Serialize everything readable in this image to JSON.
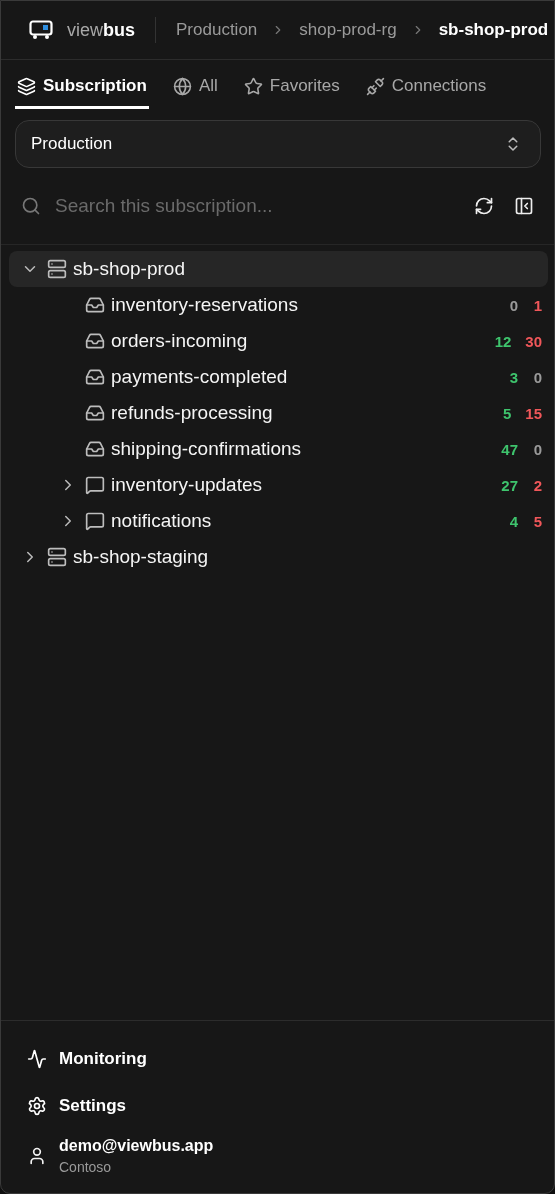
{
  "header": {
    "logo": "view**bus**",
    "breadcrumbs": [
      {
        "label": "Production",
        "current": false
      },
      {
        "label": "shop-prod-rg",
        "current": false
      },
      {
        "label": "sb-shop-prod",
        "current": true
      }
    ]
  },
  "tabs": [
    {
      "label": "Subscription",
      "selected": true
    },
    {
      "label": "All",
      "selected": false
    },
    {
      "label": "Favorites",
      "selected": false
    },
    {
      "label": "Connections",
      "selected": false
    }
  ],
  "subscription_select": {
    "value": "Production"
  },
  "search": {
    "placeholder": "Search this subscription..."
  },
  "tree": [
    {
      "kind": "namespace",
      "label": "sb-shop-prod",
      "expanded": true,
      "selected": true,
      "children": [
        {
          "kind": "queue",
          "label": "inventory-reservations",
          "counts": [
            {
              "value": "0",
              "color": "#9a9a9a"
            },
            {
              "value": "1",
              "color": "#f0575a"
            }
          ]
        },
        {
          "kind": "queue",
          "label": "orders-incoming",
          "counts": [
            {
              "value": "12",
              "color": "#3ec46d"
            },
            {
              "value": "30",
              "color": "#f0575a"
            }
          ]
        },
        {
          "kind": "queue",
          "label": "payments-completed",
          "counts": [
            {
              "value": "3",
              "color": "#3ec46d"
            },
            {
              "value": "0",
              "color": "#9a9a9a"
            }
          ]
        },
        {
          "kind": "queue",
          "label": "refunds-processing",
          "counts": [
            {
              "value": "5",
              "color": "#3ec46d"
            },
            {
              "value": "15",
              "color": "#f0575a"
            }
          ]
        },
        {
          "kind": "queue",
          "label": "shipping-confirmations",
          "counts": [
            {
              "value": "47",
              "color": "#3ec46d"
            },
            {
              "value": "0",
              "color": "#9a9a9a"
            }
          ]
        },
        {
          "kind": "topic",
          "label": "inventory-updates",
          "expanded": false,
          "counts": [
            {
              "value": "27",
              "color": "#3ec46d"
            },
            {
              "value": "2",
              "color": "#f0575a"
            }
          ]
        },
        {
          "kind": "topic",
          "label": "notifications",
          "expanded": false,
          "counts": [
            {
              "value": "4",
              "color": "#3ec46d"
            },
            {
              "value": "5",
              "color": "#f0575a"
            }
          ]
        }
      ]
    },
    {
      "kind": "namespace",
      "label": "sb-shop-staging",
      "expanded": false,
      "selected": false
    }
  ],
  "footer": {
    "links": [
      {
        "label": "Monitoring"
      },
      {
        "label": "Settings"
      }
    ],
    "user": {
      "email": "demo@viewbus.app",
      "org": "Contoso"
    }
  }
}
